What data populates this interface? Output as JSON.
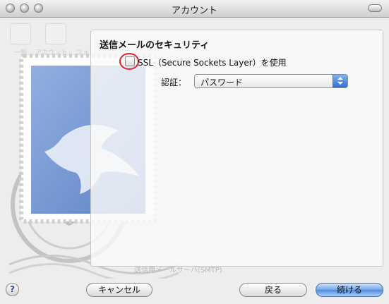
{
  "window": {
    "title": "アカウント"
  },
  "toolbar_ghost": {
    "labels": [
      "一般",
      "アカウント",
      "フォ"
    ]
  },
  "security": {
    "heading": "送信メールのセキュリティ",
    "ssl_label": "SSL（Secure Sockets Layer）を使用",
    "ssl_checked": false,
    "auth_label": "認証：",
    "auth_value": "パスワード"
  },
  "background_text": {
    "smtp_label": "送信用メールサーバ(SMTP)"
  },
  "buttons": {
    "help": "?",
    "cancel": "キャンセル",
    "back": "戻る",
    "continue": "続ける"
  },
  "icons": [
    "close-light",
    "minimize-light",
    "zoom-light",
    "toolbar-toggle",
    "help-icon",
    "select-arrows-icon",
    "mail-stamp-icon"
  ],
  "colors": {
    "accent": "#4f8be0",
    "highlight_circle": "#e0242b"
  }
}
